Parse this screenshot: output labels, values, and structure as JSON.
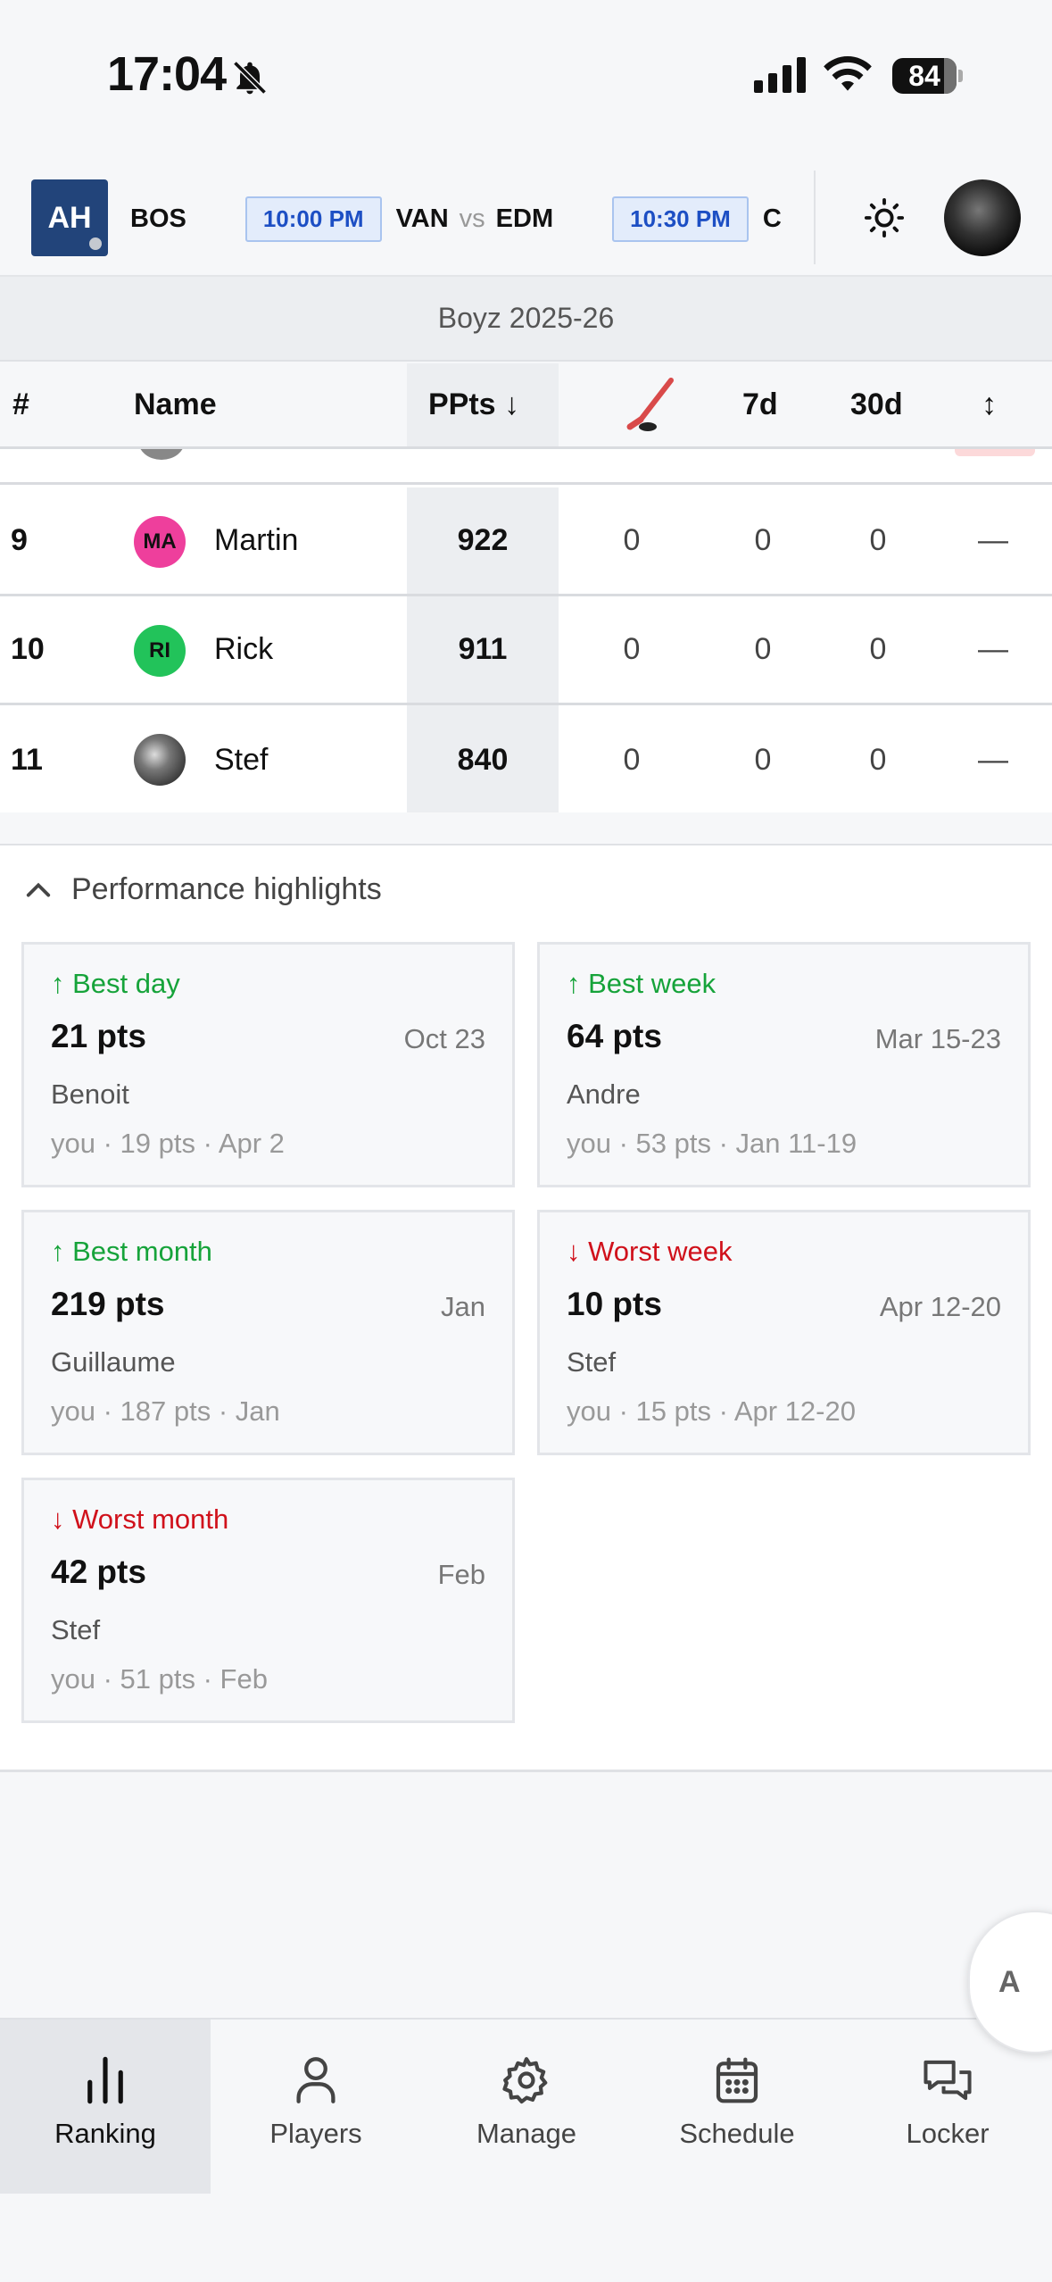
{
  "status": {
    "time": "17:04",
    "battery": "84"
  },
  "header": {
    "league_badge": "AH",
    "games": [
      {
        "left_team": "BOS",
        "time": "10:00 PM",
        "team_a": "VAN",
        "vs": "vs",
        "team_b": "EDM"
      },
      {
        "time": "10:30 PM",
        "team_a": "C"
      }
    ]
  },
  "season": "Boyz 2025-26",
  "table": {
    "headers": {
      "rank": "#",
      "name": "Name",
      "ppts": "PPts ↓",
      "d7": "7d",
      "d30": "30d",
      "move": "↕"
    },
    "rows": [
      {
        "rank": "9",
        "initials": "MA",
        "name": "Martin",
        "ppts": "922",
        "games": "0",
        "d7": "0",
        "d30": "0",
        "move": "—",
        "color": "#ee3f9c"
      },
      {
        "rank": "10",
        "initials": "RI",
        "name": "Rick",
        "ppts": "911",
        "games": "0",
        "d7": "0",
        "d30": "0",
        "move": "—",
        "color": "#22c35a"
      },
      {
        "rank": "11",
        "initials": "",
        "name": "Stef",
        "ppts": "840",
        "games": "0",
        "d7": "0",
        "d30": "0",
        "move": "—",
        "color": "#777777"
      }
    ]
  },
  "highlights": {
    "title": "Performance highlights",
    "cards": [
      {
        "label": "↑ Best day",
        "value": "21 pts",
        "date": "Oct 23",
        "who": "Benoit",
        "you": "you · 19 pts · Apr 2"
      },
      {
        "label": "↑ Best week",
        "value": "64 pts",
        "date": "Mar 15-23",
        "who": "Andre",
        "you": "you · 53 pts · Jan 11-19"
      },
      {
        "label": "↑ Best month",
        "value": "219 pts",
        "date": "Jan",
        "who": "Guillaume",
        "you": "you · 187 pts · Jan"
      },
      {
        "label": "↓ Worst week",
        "value": "10 pts",
        "date": "Apr 12-20",
        "who": "Stef",
        "you": "you · 15 pts · Apr 12-20"
      },
      {
        "label": "↓ Worst month",
        "value": "42 pts",
        "date": "Feb",
        "who": "Stef",
        "you": "you · 51 pts · Feb"
      }
    ]
  },
  "fab": "A",
  "nav": {
    "ranking": "Ranking",
    "players": "Players",
    "manage": "Manage",
    "schedule": "Schedule",
    "locker": "Locker"
  },
  "colors": {
    "up": "#16a33a",
    "down": "#d0111b",
    "accent": "#1d4fc4",
    "badge": "#22447a"
  }
}
